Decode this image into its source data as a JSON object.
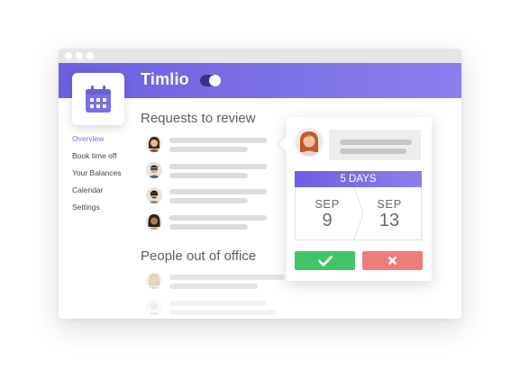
{
  "app": {
    "name": "Timlio",
    "brand_color": "#6c5fe0",
    "logo_icon": "calendar-icon"
  },
  "nav": {
    "items": [
      {
        "label": "Overview",
        "active": true
      },
      {
        "label": "Book time off",
        "active": false
      },
      {
        "label": "Your Balances",
        "active": false
      },
      {
        "label": "Calendar",
        "active": false
      },
      {
        "label": "Settings",
        "active": false
      }
    ]
  },
  "sections": {
    "requests_title": "Requests to review",
    "out_of_office_title": "People out of office"
  },
  "request_card": {
    "duration": "5 DAYS",
    "from": {
      "month": "SEP",
      "day": "9"
    },
    "to": {
      "month": "SEP",
      "day": "13"
    },
    "approve_icon": "checkmark-icon",
    "reject_icon": "close-icon",
    "approve_color": "#3fc566",
    "reject_color": "#f07b7b"
  }
}
